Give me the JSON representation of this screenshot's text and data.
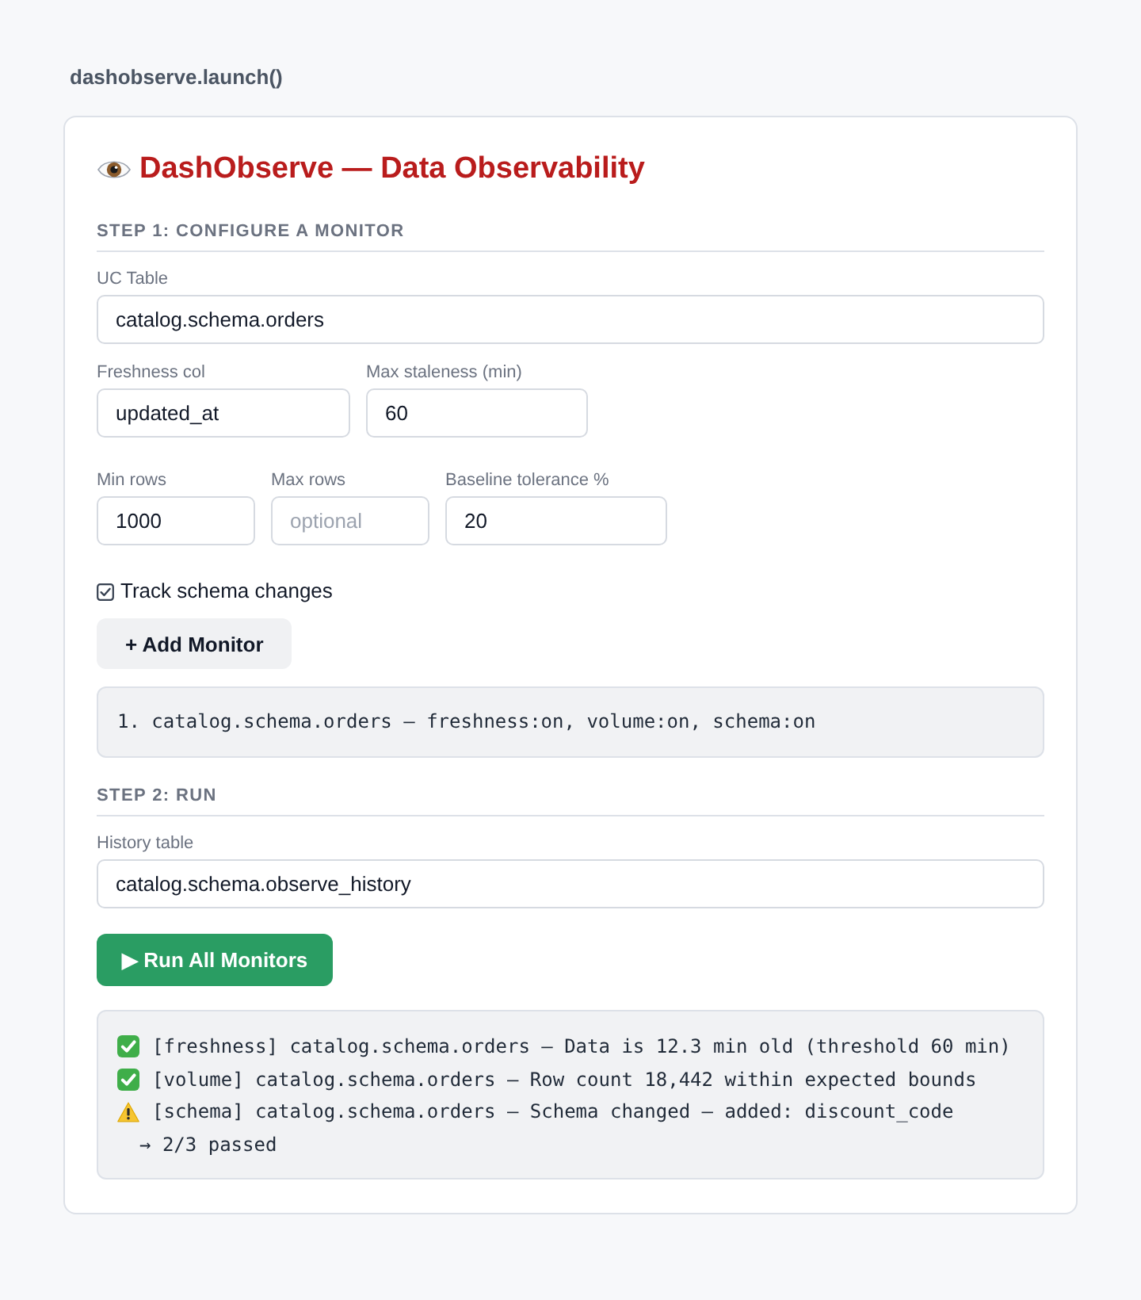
{
  "header": {
    "title": "dashobserve.launch()"
  },
  "card": {
    "title": "DashObserve — Data Observability"
  },
  "step1": {
    "heading": "STEP 1: CONFIGURE A MONITOR",
    "field_rows": [
      [
        {
          "label": "UC Table",
          "value": "catalog.schema.orders"
        }
      ],
      [
        {
          "label": "Freshness col",
          "value": "updated_at"
        },
        {
          "label": "Max staleness (min)",
          "value": "60"
        }
      ],
      [
        {
          "label": "Min rows",
          "value": "1000"
        },
        {
          "label": "Max rows",
          "placeholder": "optional"
        },
        {
          "label": "Baseline tolerance %",
          "value": "20"
        }
      ]
    ],
    "track_schema": {
      "label": "Track schema changes",
      "checked": true
    },
    "add_button": {
      "label": "+ Add Monitor"
    },
    "monitors": [
      "1. catalog.schema.orders — freshness:on, volume:on, schema:on"
    ]
  },
  "step2": {
    "heading": "STEP 2: RUN",
    "history_table": {
      "label": "History table",
      "value": "catalog.schema.observe_history"
    },
    "run_button": {
      "label": "▶ Run All Monitors"
    },
    "results": [
      {
        "kind": "pass",
        "text": "[freshness] catalog.schema.orders — Data is 12.3 min old (threshold 60 min)"
      },
      {
        "kind": "pass",
        "text": "[volume] catalog.schema.orders — Row count 18,442 within expected bounds"
      },
      {
        "kind": "warn",
        "text": "[schema] catalog.schema.orders — Schema changed — added: discount_code"
      },
      {
        "kind": "summary",
        "text": "→ 2/3 passed"
      }
    ]
  }
}
